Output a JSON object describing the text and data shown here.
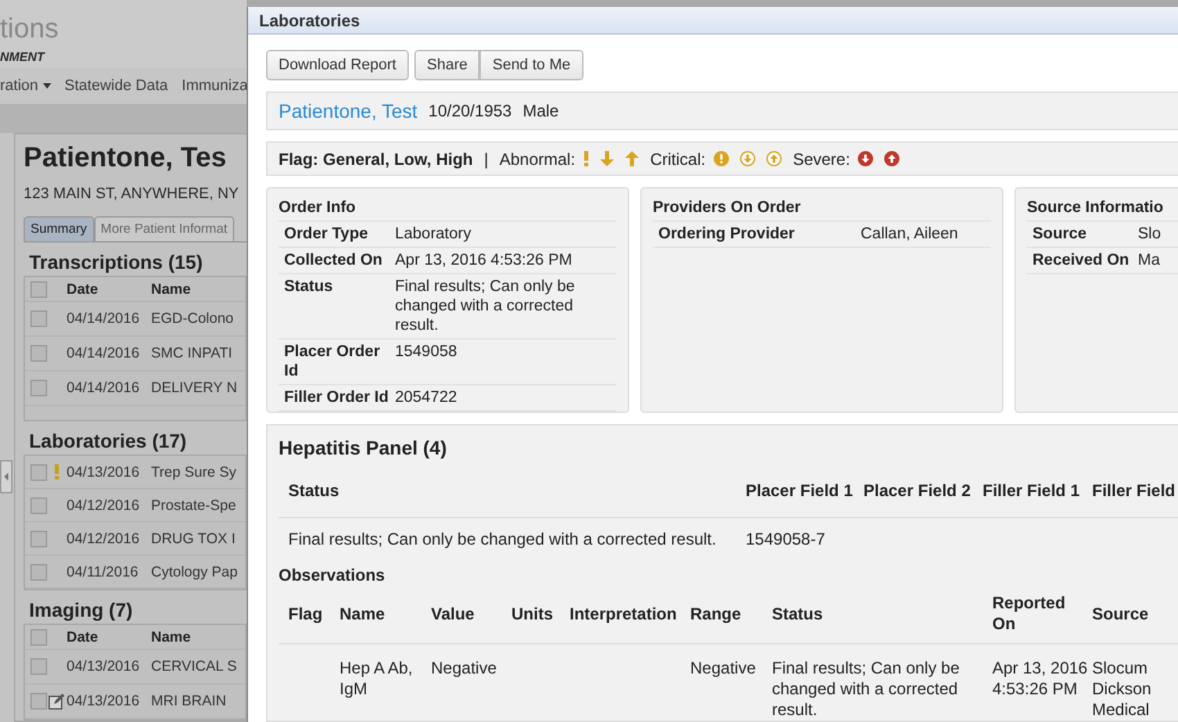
{
  "background": {
    "logo": {
      "text": "tions",
      "tagline": "NMENT"
    },
    "nav": [
      {
        "label": "ration",
        "dropdown": true
      },
      {
        "label": "Statewide Data",
        "dropdown": false
      },
      {
        "label": "Immuniza",
        "dropdown": false
      }
    ],
    "patient": {
      "name": "Patientone, Tes",
      "address": "123 MAIN ST, ANYWHERE, NY"
    },
    "tabs": [
      {
        "label": "Summary",
        "selected": true
      },
      {
        "label": "More Patient Informat",
        "selected": false
      }
    ],
    "sections": [
      {
        "title": "Transcriptions (15)",
        "columns": [
          "Date",
          "Name"
        ],
        "all_checked": false,
        "rows": [
          {
            "kind": "plain",
            "checked": false,
            "date": "04/14/2016",
            "name": "EGD-Colono"
          },
          {
            "kind": "plain",
            "checked": false,
            "date": "04/14/2016",
            "name": "SMC INPATI"
          },
          {
            "kind": "plain",
            "checked": false,
            "date": "04/14/2016",
            "name": "DELIVERY N"
          }
        ]
      },
      {
        "title": "Laboratories (17)",
        "rows": [
          {
            "kind": "flagged",
            "checked": false,
            "date": "04/13/2016",
            "name": "Trep Sure Sy"
          },
          {
            "kind": "plain",
            "checked": false,
            "date": "04/12/2016",
            "name": "Prostate-Spe"
          },
          {
            "kind": "plain",
            "checked": false,
            "date": "04/12/2016",
            "name": "DRUG TOX I"
          },
          {
            "kind": "plain",
            "checked": false,
            "date": "04/11/2016",
            "name": "Cytology Pap"
          }
        ]
      },
      {
        "title": "Imaging (7)",
        "columns": [
          "Date",
          "Name"
        ],
        "all_checked": false,
        "rows": [
          {
            "kind": "plain",
            "checked": false,
            "date": "04/13/2016",
            "name": "CERVICAL S"
          },
          {
            "kind": "note",
            "checked": false,
            "date": "04/13/2016",
            "name": "MRI BRAIN"
          }
        ]
      }
    ]
  },
  "modal": {
    "title": "Laboratories",
    "button_groups": [
      [
        "Download Report"
      ],
      [
        "Share",
        "Send to Me"
      ]
    ],
    "patient": {
      "name": "Patientone, Test",
      "dob": "10/20/1953",
      "sex": "Male"
    },
    "legend": {
      "title": "Flag: General, Low, High",
      "separator": "|",
      "groups": [
        {
          "label": "Abnormal:",
          "kind": "abnormal",
          "icons": [
            {
              "kind": "general"
            },
            {
              "kind": "low"
            },
            {
              "kind": "high"
            }
          ]
        },
        {
          "label": "Critical:",
          "kind": "critical",
          "icons": [
            {
              "kind": "general"
            },
            {
              "kind": "low"
            },
            {
              "kind": "high"
            }
          ]
        },
        {
          "label": "Severe:",
          "kind": "severe",
          "icons": [
            {
              "kind": "low"
            },
            {
              "kind": "high"
            }
          ]
        }
      ]
    },
    "cards": [
      {
        "title": "Order Info",
        "rows": [
          {
            "label": "Order Type",
            "value": "Laboratory"
          },
          {
            "label": "Collected On",
            "value": "Apr 13, 2016 4:53:26 PM"
          },
          {
            "label": "Status",
            "value": "Final results; Can only be changed with a corrected result."
          },
          {
            "label": "Placer Order Id",
            "value": "1549058"
          },
          {
            "label": "Filler Order Id",
            "value": "2054722"
          }
        ]
      },
      {
        "title": "Providers On Order",
        "rows": [
          {
            "label": "Ordering Provider",
            "value": "Callan, Aileen"
          }
        ]
      },
      {
        "title": "Source Informatio",
        "rows": [
          {
            "label": "Source",
            "value": "Slo"
          },
          {
            "label": "Received On",
            "value": "Ma"
          }
        ]
      }
    ],
    "panel": {
      "title": "Hepatitis Panel (4)",
      "columns": [
        "Status",
        "Placer Field 1",
        "Placer Field 2",
        "Filler Field 1",
        "Filler Field"
      ],
      "row": [
        "Final results; Can only be changed with a corrected result.",
        "1549058-7"
      ]
    },
    "observations": {
      "title": "Observations",
      "columns": [
        "Flag",
        "Name",
        "Value",
        "Units",
        "Interpretation",
        "Range",
        "Status",
        "Reported On",
        "Source"
      ],
      "rows": [
        {
          "name": "Hep A Ab, IgM",
          "value": "Negative",
          "range": "Negative",
          "status": "Final results; Can only be changed with a corrected result.",
          "reported_on": "Apr 13, 2016 4:53:26 PM",
          "source": "Slocum Dickson Medical"
        }
      ]
    }
  }
}
